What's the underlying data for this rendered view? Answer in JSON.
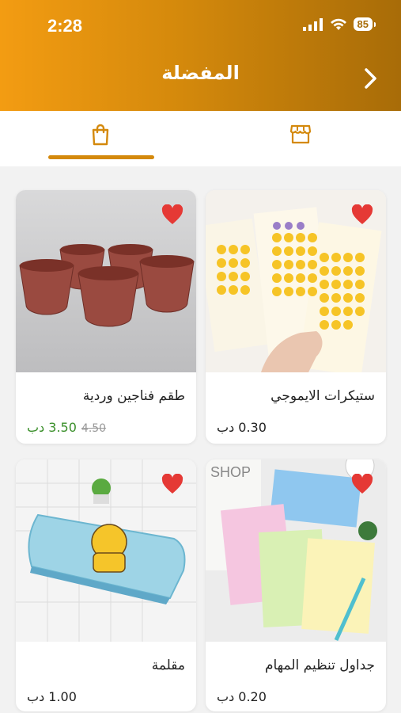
{
  "status": {
    "time": "2:28",
    "battery": "85"
  },
  "header": {
    "title": "المفضلة"
  },
  "tabs": [
    {
      "name": "favorites-tab",
      "icon": "shopping-bag-icon",
      "active": true
    },
    {
      "name": "store-tab",
      "icon": "store-icon",
      "active": false
    }
  ],
  "colors": {
    "accent": "#d4890c",
    "heart": "#e53935",
    "sale": "#3a8f2a"
  },
  "products": [
    {
      "name": "ستيكرات الايموجي",
      "price": "0.30 دب",
      "old_price": ""
    },
    {
      "name": "طقم فناجين وردية",
      "price": "3.50 دب",
      "old_price": "4.50"
    },
    {
      "name": "جداول تنظيم المهام",
      "price": "0.20 دب",
      "old_price": ""
    },
    {
      "name": "مقلمة",
      "price": "1.00 دب",
      "old_price": ""
    }
  ]
}
